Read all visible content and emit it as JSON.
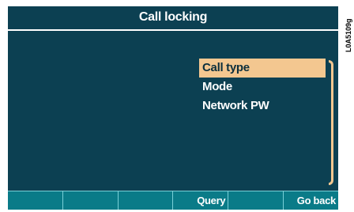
{
  "screen": {
    "title": "Call locking",
    "menu": {
      "items": [
        {
          "label": "Call type",
          "selected": true
        },
        {
          "label": "Mode",
          "selected": false
        },
        {
          "label": "Network PW",
          "selected": false
        }
      ]
    },
    "softkeys": [
      "",
      "",
      "",
      "Query",
      "",
      "Go back"
    ]
  },
  "figure_ref": "L0A5109g",
  "colors": {
    "background": "#0c4052",
    "highlight": "#f3c790",
    "softkey_bar": "#0a7b88"
  }
}
